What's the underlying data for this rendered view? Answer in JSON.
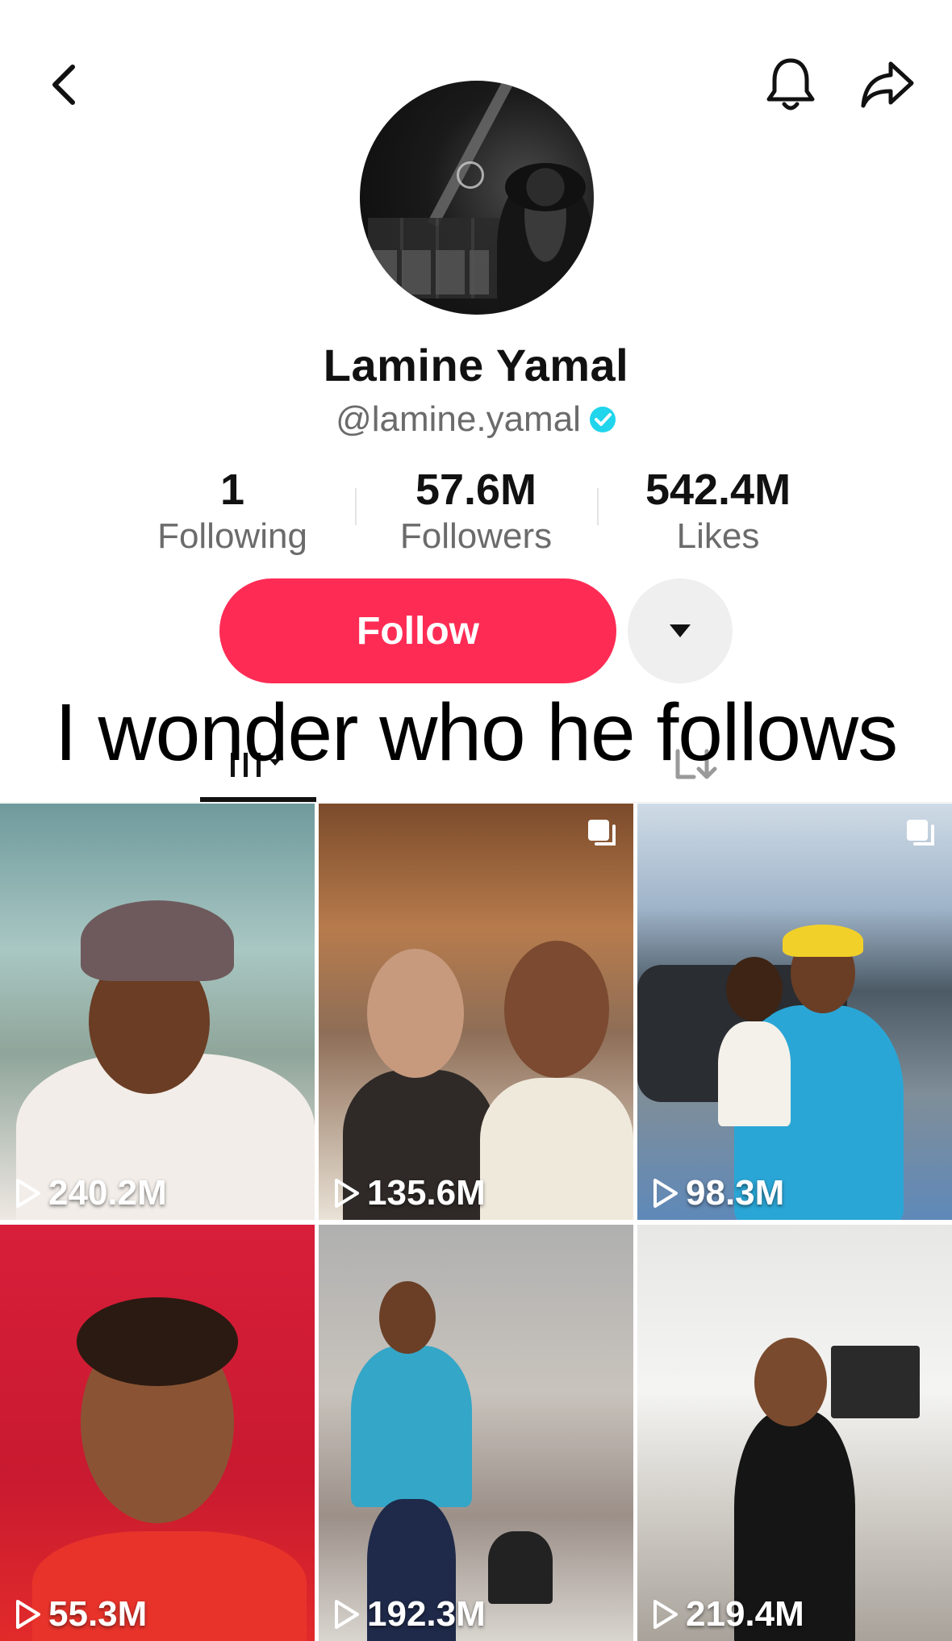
{
  "profile": {
    "name": "Lamine Yamal",
    "handle": "@lamine.yamal",
    "verified": true
  },
  "stats": [
    {
      "value": "1",
      "label": "Following"
    },
    {
      "value": "57.6M",
      "label": "Followers"
    },
    {
      "value": "542.4M",
      "label": "Likes"
    }
  ],
  "actions": {
    "follow_label": "Follow"
  },
  "caption": "I wonder who he follows",
  "tabs": {
    "active": "videos",
    "items": [
      "videos-icon",
      "reposts-icon"
    ]
  },
  "videos": [
    {
      "views": "240.2M",
      "multi": false
    },
    {
      "views": "135.6M",
      "multi": true
    },
    {
      "views": "98.3M",
      "multi": true
    },
    {
      "views": "55.3M",
      "multi": false
    },
    {
      "views": "192.3M",
      "multi": false
    },
    {
      "views": "219.4M",
      "multi": false
    }
  ],
  "colors": {
    "accent": "#fe2c55",
    "verified": "#20d5ec",
    "muted_text": "#6b6b6b"
  }
}
